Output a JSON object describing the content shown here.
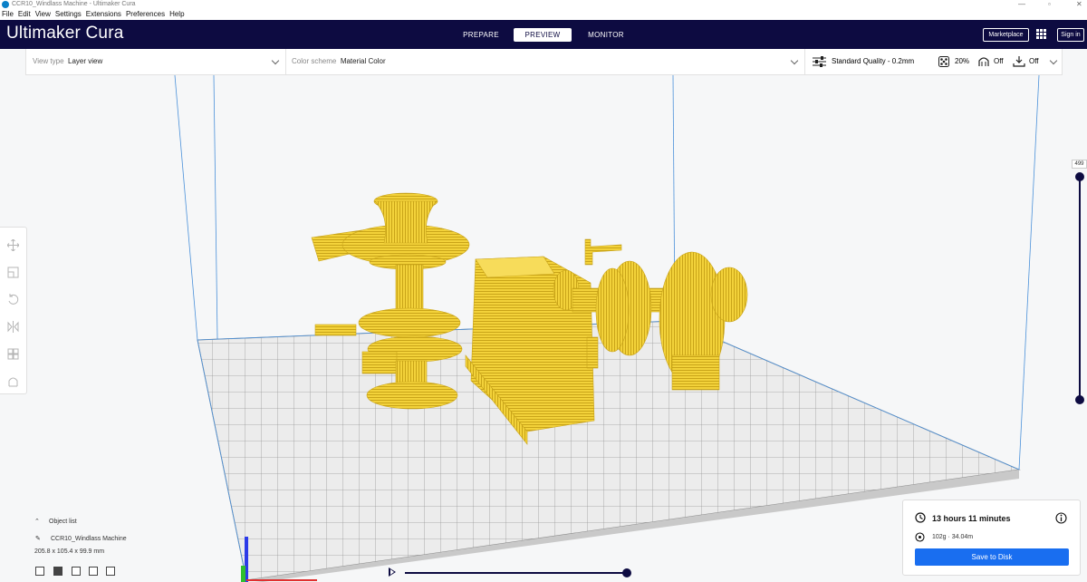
{
  "window": {
    "title": "CCR10_Windlass Machine - Ultimaker Cura"
  },
  "menu": [
    "File",
    "Edit",
    "View",
    "Settings",
    "Extensions",
    "Preferences",
    "Help"
  ],
  "header": {
    "brand_light": "Ultimaker",
    "brand_bold": " Cura",
    "tabs": [
      {
        "label": "PREPARE",
        "active": false
      },
      {
        "label": "PREVIEW",
        "active": true
      },
      {
        "label": "MONITOR",
        "active": false
      }
    ],
    "marketplace": "Marketplace",
    "signin": "Sign in"
  },
  "toolbar": {
    "view_type_label": "View type",
    "view_type_value": "Layer view",
    "color_scheme_label": "Color scheme",
    "color_scheme_value": "Material Color",
    "quality": "Standard Quality - 0.2mm",
    "infill": "20%",
    "support": "Off",
    "adhesion": "Off"
  },
  "layer_slider": {
    "current_layer": "499"
  },
  "object_list": {
    "toggle_label": "Object list",
    "object_name": "CCR10_Windlass Machine",
    "dimensions": "205.8 x 105.4 x 99.9 mm"
  },
  "print_info": {
    "time": "13 hours 11 minutes",
    "material": "102g · 34.04m",
    "save_label": "Save to Disk"
  },
  "colors": {
    "header": "#0d0b41",
    "accent": "#196ef0",
    "model": "#f5cc2a",
    "plate": "#dcdcdc"
  }
}
